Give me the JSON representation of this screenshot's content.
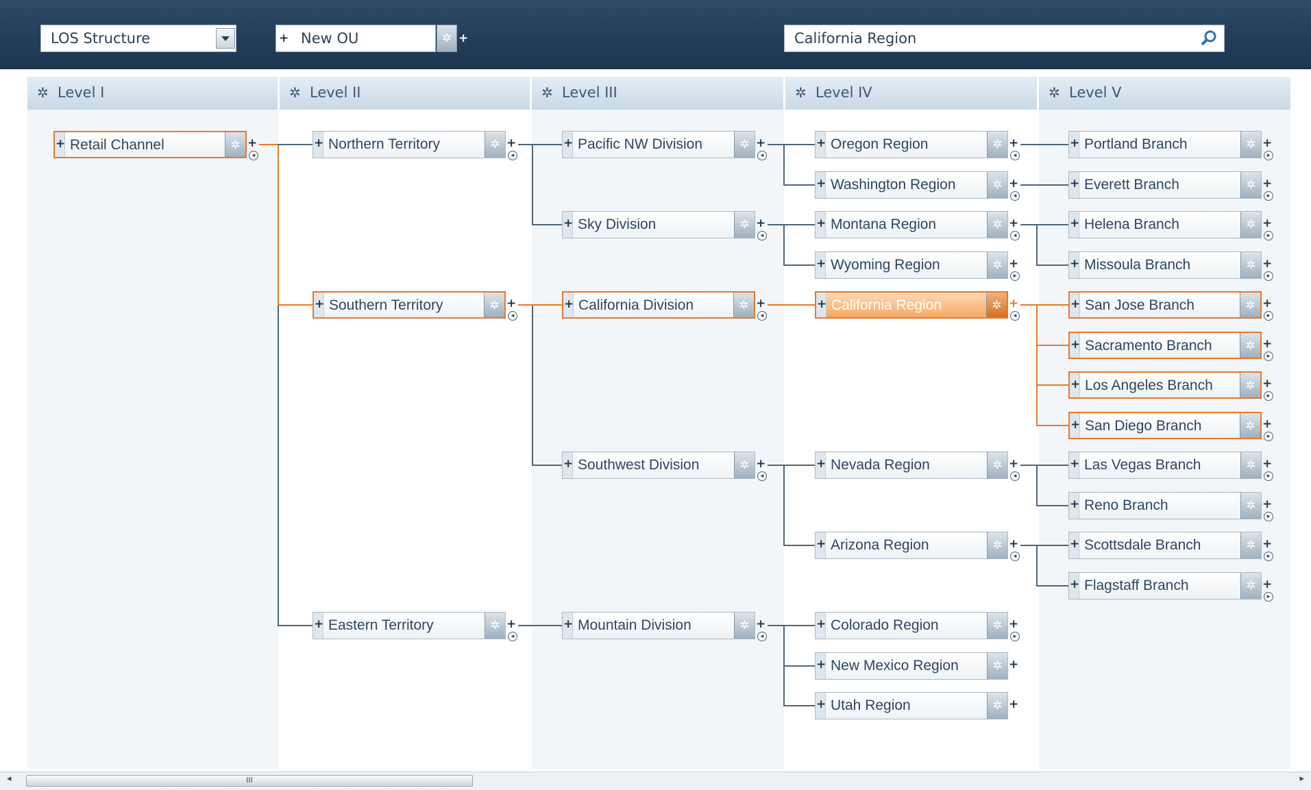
{
  "toolbar": {
    "structure_select": {
      "value": "LOS Structure"
    },
    "new_ou": {
      "value": "New OU"
    },
    "search": {
      "value": "California Region"
    }
  },
  "levels": [
    "Level I",
    "Level II",
    "Level III",
    "Level IV",
    "Level V"
  ],
  "nodes": [
    {
      "id": "retail-channel",
      "label": "Retail Channel",
      "level": 1,
      "state": "path"
    },
    {
      "id": "northern-territory",
      "label": "Northern Territory",
      "level": 2,
      "state": "normal"
    },
    {
      "id": "southern-territory",
      "label": "Southern Territory",
      "level": 2,
      "state": "path"
    },
    {
      "id": "eastern-territory",
      "label": "Eastern Territory",
      "level": 2,
      "state": "normal"
    },
    {
      "id": "pacific-nw-division",
      "label": "Pacific NW Division",
      "level": 3,
      "state": "normal"
    },
    {
      "id": "sky-division",
      "label": "Sky Division",
      "level": 3,
      "state": "normal"
    },
    {
      "id": "california-division",
      "label": "California Division",
      "level": 3,
      "state": "path"
    },
    {
      "id": "southwest-division",
      "label": "Southwest Division",
      "level": 3,
      "state": "normal"
    },
    {
      "id": "mountain-division",
      "label": "Mountain Division",
      "level": 3,
      "state": "normal"
    },
    {
      "id": "oregon-region",
      "label": "Oregon Region",
      "level": 4,
      "state": "normal"
    },
    {
      "id": "washington-region",
      "label": "Washington Region",
      "level": 4,
      "state": "normal"
    },
    {
      "id": "montana-region",
      "label": "Montana Region",
      "level": 4,
      "state": "normal"
    },
    {
      "id": "wyoming-region",
      "label": "Wyoming Region",
      "level": 4,
      "state": "normal"
    },
    {
      "id": "california-region",
      "label": "California Region",
      "level": 4,
      "state": "selected"
    },
    {
      "id": "nevada-region",
      "label": "Nevada Region",
      "level": 4,
      "state": "normal"
    },
    {
      "id": "arizona-region",
      "label": "Arizona Region",
      "level": 4,
      "state": "normal"
    },
    {
      "id": "colorado-region",
      "label": "Colorado Region",
      "level": 4,
      "state": "normal"
    },
    {
      "id": "new-mexico-region",
      "label": "New Mexico Region",
      "level": 4,
      "state": "normal"
    },
    {
      "id": "utah-region",
      "label": "Utah Region",
      "level": 4,
      "state": "normal"
    },
    {
      "id": "portland-branch",
      "label": "Portland Branch",
      "level": 5,
      "state": "normal"
    },
    {
      "id": "everett-branch",
      "label": "Everett  Branch",
      "level": 5,
      "state": "normal"
    },
    {
      "id": "helena-branch",
      "label": "Helena Branch",
      "level": 5,
      "state": "normal"
    },
    {
      "id": "missoula-branch",
      "label": "Missoula Branch",
      "level": 5,
      "state": "normal"
    },
    {
      "id": "san-jose-branch",
      "label": "San Jose Branch",
      "level": 5,
      "state": "path"
    },
    {
      "id": "sacramento-branch",
      "label": "Sacramento Branch",
      "level": 5,
      "state": "path"
    },
    {
      "id": "los-angeles-branch",
      "label": "Los Angeles Branch",
      "level": 5,
      "state": "path"
    },
    {
      "id": "san-diego-branch",
      "label": "San Diego Branch",
      "level": 5,
      "state": "path"
    },
    {
      "id": "las-vegas-branch",
      "label": "Las Vegas Branch",
      "level": 5,
      "state": "normal"
    },
    {
      "id": "reno-branch",
      "label": "Reno Branch",
      "level": 5,
      "state": "normal"
    },
    {
      "id": "scottsdale-branch",
      "label": "Scottsdale Branch",
      "level": 5,
      "state": "normal"
    },
    {
      "id": "flagstaff-branch",
      "label": "Flagstaff Branch",
      "level": 5,
      "state": "normal"
    }
  ],
  "scrollbar": {
    "grip": "III"
  },
  "colors": {
    "toolbar": "#1c3550",
    "accent": "#e8782a",
    "connector": "#4e6478"
  }
}
